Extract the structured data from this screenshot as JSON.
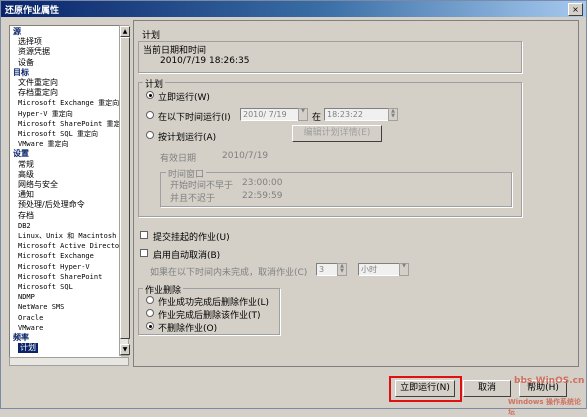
{
  "window": {
    "title": "还原作业属性",
    "close_glyph": "×"
  },
  "tree": {
    "items": [
      {
        "text": "源",
        "type": "cat"
      },
      {
        "text": "选择项",
        "type": "item"
      },
      {
        "text": "资源凭据",
        "type": "item"
      },
      {
        "text": "设备",
        "type": "item"
      },
      {
        "text": "目标",
        "type": "cat"
      },
      {
        "text": "文件重定向",
        "type": "item"
      },
      {
        "text": "存档重定向",
        "type": "item"
      },
      {
        "text": "Microsoft Exchange 重定向",
        "type": "item",
        "mono": true
      },
      {
        "text": "Hyper-V 重定向",
        "type": "item",
        "mono": true
      },
      {
        "text": "Microsoft SharePoint 重定向",
        "type": "item",
        "mono": true
      },
      {
        "text": "Microsoft SQL 重定向",
        "type": "item",
        "mono": true
      },
      {
        "text": "VMware 重定向",
        "type": "item",
        "mono": true
      },
      {
        "text": "设置",
        "type": "cat"
      },
      {
        "text": "常规",
        "type": "item"
      },
      {
        "text": "高级",
        "type": "item"
      },
      {
        "text": "网络与安全",
        "type": "item"
      },
      {
        "text": "通知",
        "type": "item"
      },
      {
        "text": "预处理/后处理命令",
        "type": "item"
      },
      {
        "text": "存档",
        "type": "item"
      },
      {
        "text": "DB2",
        "type": "item",
        "mono": true
      },
      {
        "text": "Linux、Unix 和 Macintosh",
        "type": "item",
        "mono": true
      },
      {
        "text": "Microsoft Active Directory",
        "type": "item",
        "mono": true
      },
      {
        "text": "Microsoft Exchange",
        "type": "item",
        "mono": true
      },
      {
        "text": "Microsoft Hyper-V",
        "type": "item",
        "mono": true
      },
      {
        "text": "Microsoft SharePoint",
        "type": "item",
        "mono": true
      },
      {
        "text": "Microsoft SQL",
        "type": "item",
        "mono": true
      },
      {
        "text": "NDMP",
        "type": "item",
        "mono": true
      },
      {
        "text": "NetWare SMS",
        "type": "item",
        "mono": true
      },
      {
        "text": "Oracle",
        "type": "item",
        "mono": true
      },
      {
        "text": "VMware",
        "type": "item",
        "mono": true
      },
      {
        "text": "频率",
        "type": "cat"
      },
      {
        "text": "计划",
        "type": "item",
        "selected": true
      }
    ],
    "scroll_up": "▲",
    "scroll_down": "▼"
  },
  "plan": {
    "section_title": "计划",
    "datetime_group": "当前日期和时间",
    "datetime_value": "2010/7/19   18:26:35",
    "schedule_group": "计划",
    "run_now": "立即运行(W)",
    "run_at": "在以下时间运行(I)",
    "run_at_date": "2010/ 7/19",
    "run_at_on": "在",
    "run_at_time": "18:23:22",
    "by_schedule": "按计划运行(A)",
    "edit_schedule_btn": "编辑计划详情(E)",
    "effective_date_label": "有效日期",
    "effective_date_value": "2010/7/19",
    "time_window_group": "时间窗口",
    "start_no_earlier_label": "开始时间不早于",
    "start_no_earlier_value": "23:00:00",
    "no_later_label": "并且不迟于",
    "no_later_value": "22:59:59",
    "submit_on_hold": "提交挂起的作业(U)",
    "auto_cancel": "启用自动取消(B)",
    "cancel_if_not_done": "如果在以下时间内未完成，取消作业(C)",
    "cancel_value": "3",
    "cancel_unit": "小时",
    "delete_group": "作业删除",
    "del_success": "作业成功完成后删除作业(L)",
    "del_complete": "作业完成后删除该作业(T)",
    "del_never": "不删除作业(O)"
  },
  "footer": {
    "run_now": "立即运行(N)",
    "cancel": "取消",
    "help": "帮助(H)"
  },
  "watermark": {
    "line1": "bbs.WinOS.cn",
    "line2": "Windows 操作系统论坛"
  },
  "colors": {
    "highlight": "#e01010",
    "selection": "#0a246a",
    "title_gradient_start": "#0a246a"
  }
}
